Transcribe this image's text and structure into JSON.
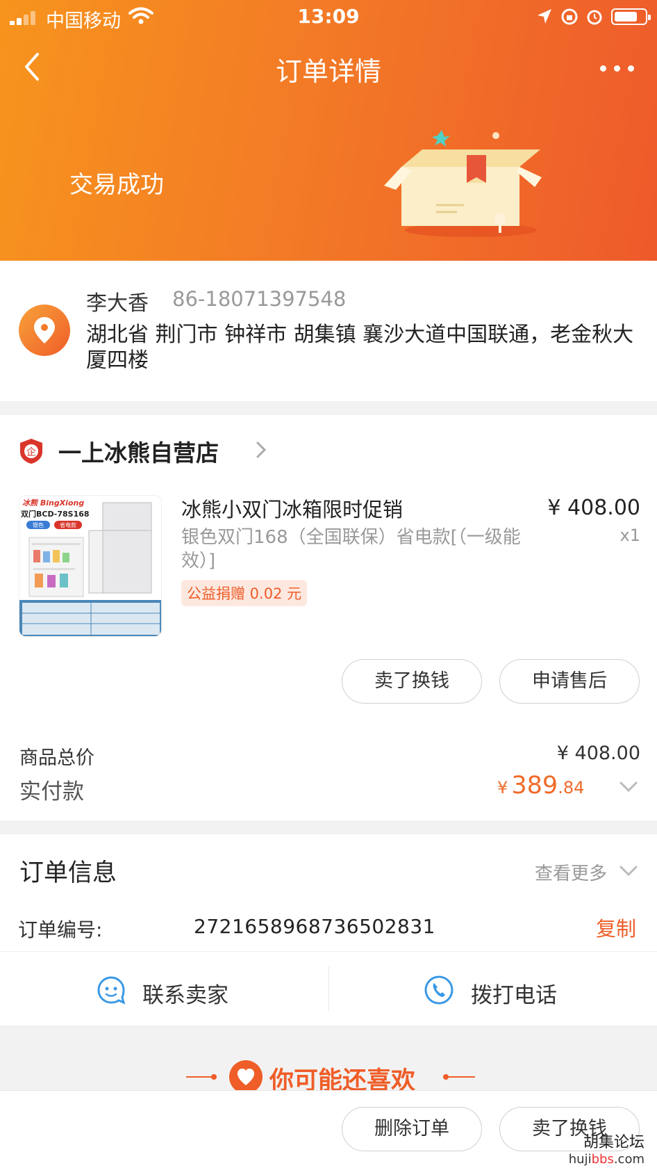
{
  "status_bar": {
    "carrier": "中国移动",
    "time": "13:09"
  },
  "nav": {
    "title": "订单详情"
  },
  "order_status": "交易成功",
  "address": {
    "name": "李大香",
    "phone": "86-18071397548",
    "line": "湖北省 荆门市 钟祥市 胡集镇 襄沙大道中国联通，老金秋大厦四楼"
  },
  "shop": {
    "name": "一上冰熊自营店"
  },
  "product": {
    "title": "冰熊小双门冰箱限时促销",
    "spec": "银色双门168（全国联保）省电款[（一级能效）]",
    "price": "¥ 408.00",
    "qty": "x1",
    "donation": "公益捐赠 0.02 元",
    "image_brand": "冰熊 BingXiong",
    "image_model": "双门BCD-78S168",
    "image_tag1": "银色",
    "image_tag2": "省电款"
  },
  "actions": {
    "sell_exchange": "卖了换钱",
    "after_sale": "申请售后",
    "delete_order": "删除订单"
  },
  "totals": {
    "goods_total_label": "商品总价",
    "goods_total_value": "¥ 408.00",
    "paid_label": "实付款",
    "paid_symbol": "¥",
    "paid_int": "389",
    "paid_dec": ".84"
  },
  "order_info": {
    "title": "订单信息",
    "see_more": "查看更多",
    "order_no_label": "订单编号:",
    "order_no": "2721658968736502831",
    "copy": "复制"
  },
  "contact": {
    "seller": "联系卖家",
    "call": "拨打电话"
  },
  "recommend": {
    "title": "你可能还喜欢"
  },
  "watermark": {
    "line1": "胡集论坛",
    "line2_a": "huji",
    "line2_b": "bbs",
    "line2_c": ".com"
  },
  "colors": {
    "accent": "#ef5d28",
    "gradient_start": "#f7941d",
    "gradient_end": "#ee5a2b"
  }
}
